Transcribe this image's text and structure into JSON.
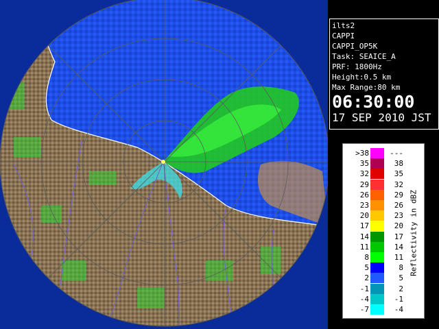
{
  "info": {
    "station": "ilts2",
    "product": "CAPPI",
    "product_id": "CAPPI_OP5K",
    "task": "Task: SEAICE_A",
    "prf": "PRF: 1800Hz",
    "height": "Height:0.5 km",
    "max_range": "Max Range:80 km",
    "time": "06:30:00",
    "date": "17 SEP 2010 JST"
  },
  "legend": {
    "unit_label": "Reflectivity in dBZ",
    "rows": [
      {
        "lo": ">38",
        "hi": "---",
        "color": "#ff00ff"
      },
      {
        "lo": "35",
        "hi": "38",
        "color": "#b00050"
      },
      {
        "lo": "32",
        "hi": "35",
        "color": "#e00000"
      },
      {
        "lo": "29",
        "hi": "32",
        "color": "#ff3030"
      },
      {
        "lo": "26",
        "hi": "29",
        "color": "#ff6000"
      },
      {
        "lo": "23",
        "hi": "26",
        "color": "#ff9000"
      },
      {
        "lo": "20",
        "hi": "23",
        "color": "#ffc800"
      },
      {
        "lo": "17",
        "hi": "20",
        "color": "#ffff00"
      },
      {
        "lo": "14",
        "hi": "17",
        "color": "#009600"
      },
      {
        "lo": "11",
        "hi": "14",
        "color": "#00c800"
      },
      {
        "lo": "8",
        "hi": "11",
        "color": "#00ff00"
      },
      {
        "lo": "5",
        "hi": "8",
        "color": "#0000ff"
      },
      {
        "lo": "2",
        "hi": "5",
        "color": "#1e5aff"
      },
      {
        "lo": "-1",
        "hi": "2",
        "color": "#0096b4"
      },
      {
        "lo": "-4",
        "hi": "-1",
        "color": "#00c8c8"
      },
      {
        "lo": "-7",
        "hi": "-4",
        "color": "#00ffff"
      }
    ]
  },
  "colors": {
    "sea": "#0a2b9a",
    "coverage": "#1d4fe8",
    "land": "#8a7355",
    "land_dark": "#5c4530",
    "coastline": "#ffffff",
    "rivers": "#7060d0",
    "rings": "#5a5a5a",
    "echo_main": "#22d822",
    "echo_cyan": "#40e0e0"
  }
}
